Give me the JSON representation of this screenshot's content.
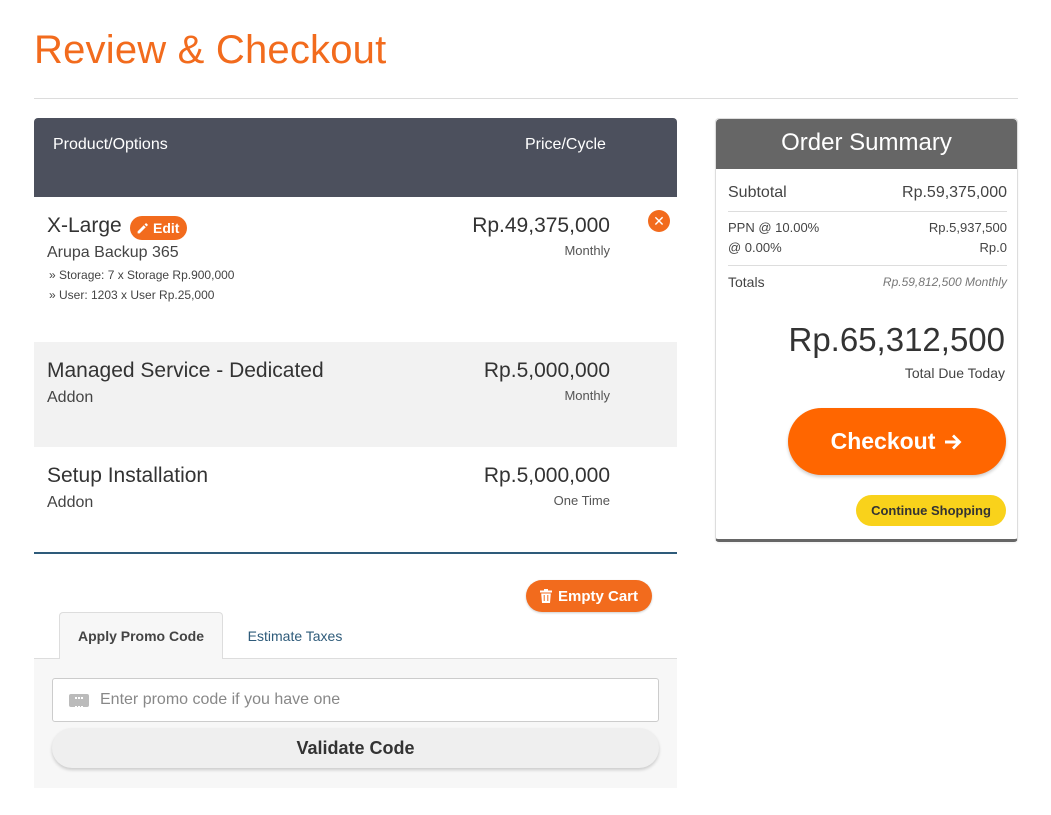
{
  "page": {
    "title": "Review & Checkout"
  },
  "cart": {
    "headers": {
      "product": "Product/Options",
      "price": "Price/Cycle"
    },
    "items": [
      {
        "name": "X-Large",
        "group": "Arupa Backup 365",
        "options": [
          "» Storage: 7 x Storage Rp.900,000",
          "» User: 1203 x User Rp.25,000"
        ],
        "price": "Rp.49,375,000",
        "cycle": "Monthly",
        "edit_label": "Edit"
      },
      {
        "name": "Managed Service - Dedicated",
        "group": "Addon",
        "price": "Rp.5,000,000",
        "cycle": "Monthly"
      },
      {
        "name": "Setup Installation",
        "group": "Addon",
        "price": "Rp.5,000,000",
        "cycle": "One Time"
      }
    ],
    "empty_cart_label": "Empty Cart"
  },
  "promo": {
    "tabs": [
      {
        "label": "Apply Promo Code"
      },
      {
        "label": "Estimate Taxes"
      }
    ],
    "placeholder": "Enter promo code if you have one",
    "value": "",
    "validate_label": "Validate Code"
  },
  "summary": {
    "title": "Order Summary",
    "subtotal_label": "Subtotal",
    "subtotal": "Rp.59,375,000",
    "taxes": [
      {
        "label": "PPN @ 10.00%",
        "value": "Rp.5,937,500"
      },
      {
        "label": "@ 0.00%",
        "value": "Rp.0"
      }
    ],
    "totals_label": "Totals",
    "totals_value": "Rp.59,812,500 Monthly",
    "total_due": "Rp.65,312,500",
    "total_due_label": "Total Due Today",
    "checkout_label": "Checkout",
    "continue_label": "Continue Shopping"
  },
  "colors": {
    "accent": "#f26b1d",
    "header_bg": "#4c505d",
    "summary_bg": "#666666",
    "continue_bg": "#f9d21b",
    "link": "#2e5b7a"
  },
  "icons": {
    "edit": "pencil-icon",
    "remove": "times-circle-icon",
    "trash": "trash-icon",
    "ticket": "ticket-icon",
    "arrow": "arrow-right-icon"
  }
}
